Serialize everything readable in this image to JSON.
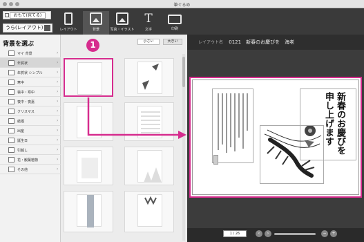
{
  "window": {
    "title": "筆ぐるめ"
  },
  "toolbar": {
    "front_mode_label": "おもて(宛てる)",
    "layout_mode_label": "うら(レイアウト)",
    "tools": [
      {
        "label": "レイアウト",
        "icon": "layout-icon"
      },
      {
        "label": "背景",
        "icon": "background-icon"
      },
      {
        "label": "写真・イラスト",
        "icon": "photo-illustration-icon"
      },
      {
        "label": "文字",
        "icon": "text-icon"
      },
      {
        "label": "印刷",
        "icon": "print-icon"
      }
    ],
    "active_tool": "背景"
  },
  "panel": {
    "title": "背景を選ぶ",
    "size_small": "小さい",
    "size_large": "大きい",
    "categories": [
      {
        "label": "マイ 背景"
      },
      {
        "label": "年賀状"
      },
      {
        "label": "年賀状 シンプル"
      },
      {
        "label": "寒中"
      },
      {
        "label": "喪中・寒中"
      },
      {
        "label": "喪中・喪嘉"
      },
      {
        "label": "クリスマス"
      },
      {
        "label": "結婚"
      },
      {
        "label": "出産"
      },
      {
        "label": "誕生日"
      },
      {
        "label": "引越し"
      },
      {
        "label": "花・観葉植物"
      },
      {
        "label": "その他"
      }
    ],
    "selected_category": "年賀状"
  },
  "preview": {
    "layout_label": "レイアウト名",
    "layout_name": "0121　新春のお慶びを　海老",
    "card_sender_text": "新春のお慶びを申し上げます",
    "page_indicator": "1 / 26"
  },
  "annotation": {
    "step_number": "1",
    "accent_color": "#d62c8e"
  }
}
